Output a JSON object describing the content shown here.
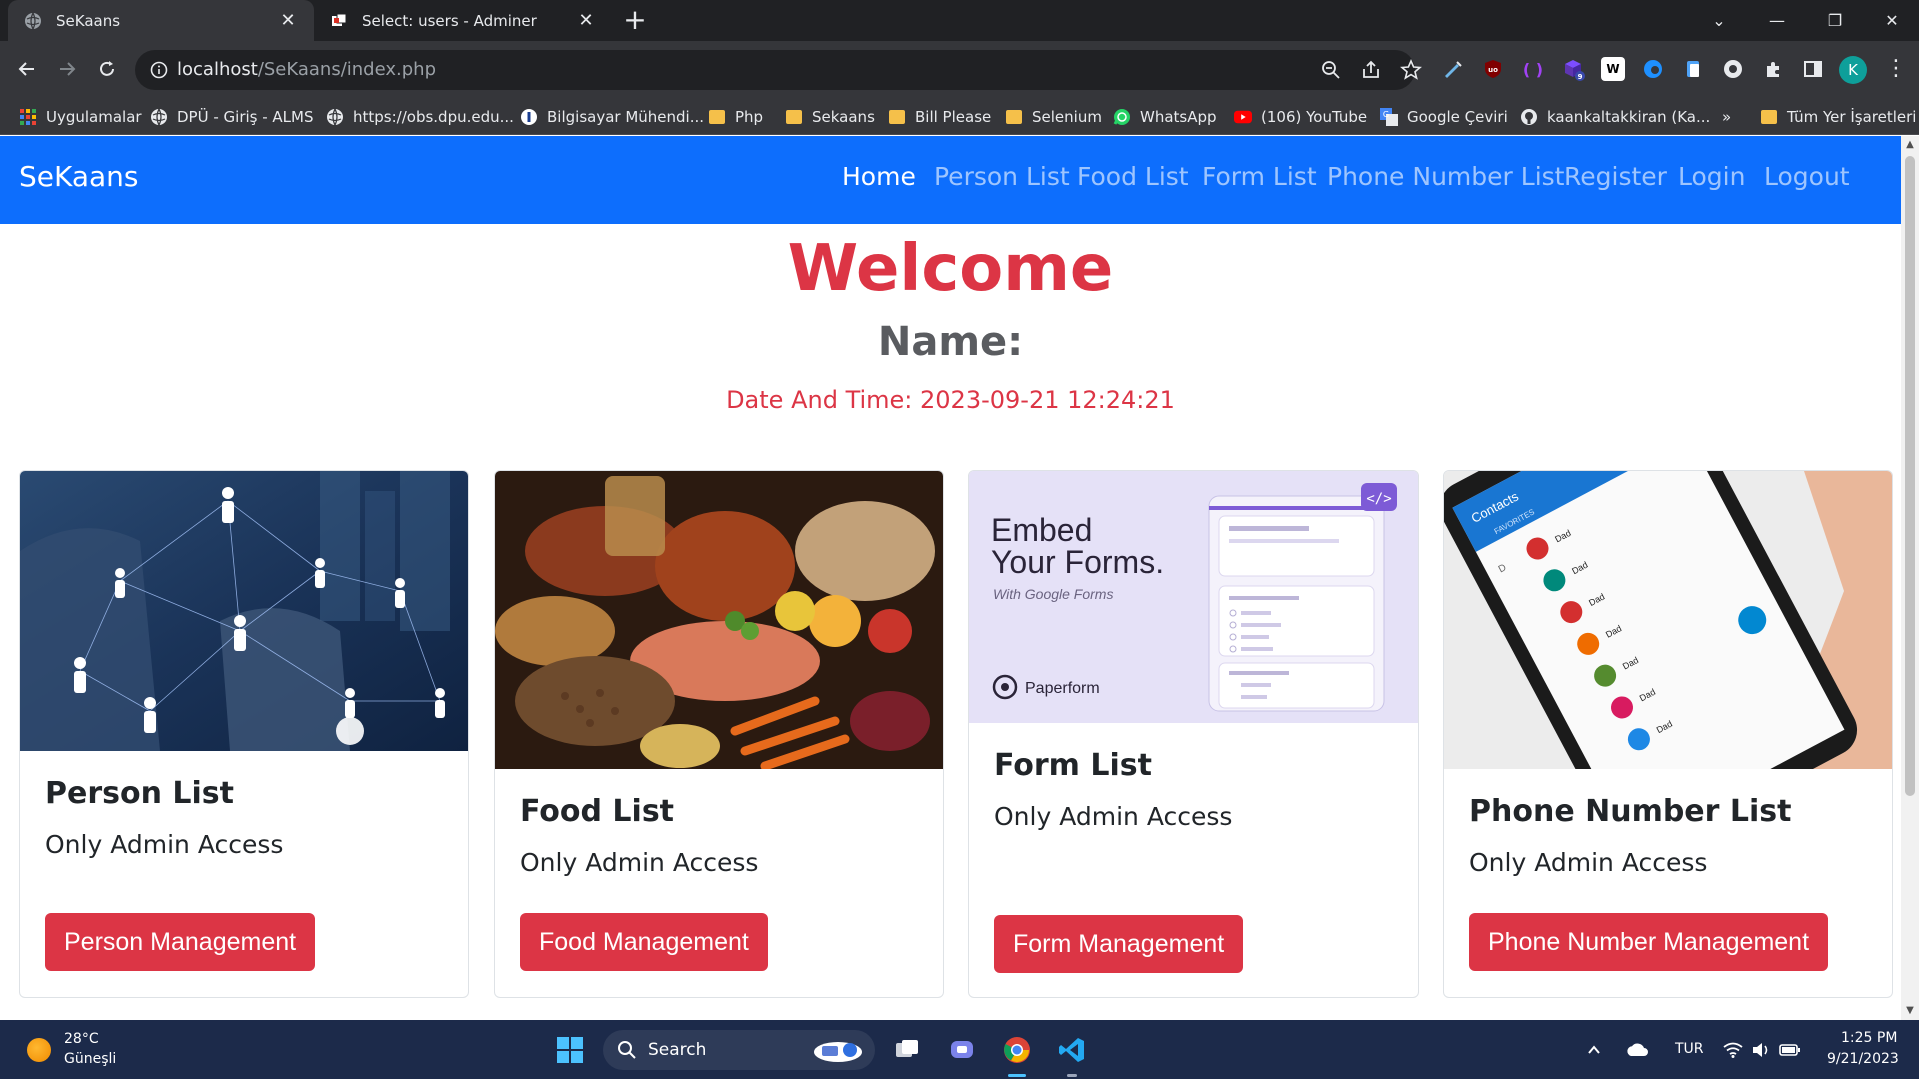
{
  "browser": {
    "tabs": [
      {
        "title": "SeKaans",
        "active": true
      },
      {
        "title": "Select: users - Adminer",
        "active": false
      }
    ],
    "address": {
      "host": "localhost",
      "path": "/SeKaans/index.php"
    },
    "profile_initial": "K",
    "extension_badge": "9",
    "bookmarks": [
      {
        "label": "Uygulamalar",
        "icon": "apps-grid-icon"
      },
      {
        "label": "DPÜ - Giriş - ALMS",
        "icon": "globe-icon"
      },
      {
        "label": "https://obs.dpu.edu...",
        "icon": "globe-icon"
      },
      {
        "label": "Bilgisayar Mühendi...",
        "icon": "dpu-logo-icon"
      },
      {
        "label": "Php",
        "icon": "folder-icon"
      },
      {
        "label": "Sekaans",
        "icon": "folder-icon"
      },
      {
        "label": "Bill Please",
        "icon": "folder-icon"
      },
      {
        "label": "Selenium",
        "icon": "folder-icon"
      },
      {
        "label": "WhatsApp",
        "icon": "whatsapp-icon"
      },
      {
        "label": "(106) YouTube",
        "icon": "youtube-icon"
      },
      {
        "label": "Google Çeviri",
        "icon": "google-translate-icon"
      },
      {
        "label": "kaankaltakkiran (Ka...",
        "icon": "github-icon"
      }
    ],
    "bookmarks_overflow": "»",
    "other_bookmarks": "Tüm Yer İşaretleri"
  },
  "navbar": {
    "brand": "SeKaans",
    "links": [
      "Home",
      "Person List",
      "Food List",
      "Form List",
      "Phone Number List",
      "Register",
      "Login",
      "Logout"
    ],
    "active": "Home",
    "color": "#0d6efd"
  },
  "hero": {
    "welcome": "Welcome",
    "name": "Name:",
    "datetime": "Date And Time: 2023-09-21 12:24:21",
    "accent": "#dc3545"
  },
  "cards": [
    {
      "title": "Person List",
      "text": "Only Admin Access",
      "button": "Person Management",
      "image": "network-people-image"
    },
    {
      "title": "Food List",
      "text": "Only Admin Access",
      "button": "Food Management",
      "image": "food-spread-image"
    },
    {
      "title": "Form List",
      "text": "Only Admin Access",
      "button": "Form Management",
      "image": "embed-forms-image",
      "image_text": {
        "line1": "Embed",
        "line2": "Your Forms.",
        "sub": "With Google Forms",
        "brand": "Paperform",
        "code": "</>"
      }
    },
    {
      "title": "Phone Number List",
      "text": "Only Admin Access",
      "button": "Phone Number Management",
      "image": "phone-contacts-image",
      "image_text": {
        "header": "Contacts",
        "tab": "FAVORITES",
        "letter": "D",
        "contact": "Dad"
      }
    }
  ],
  "taskbar": {
    "weather_temp": "28°C",
    "weather_desc": "Güneşli",
    "search": "Search",
    "language": "TUR",
    "time": "1:25 PM",
    "date": "9/21/2023"
  }
}
